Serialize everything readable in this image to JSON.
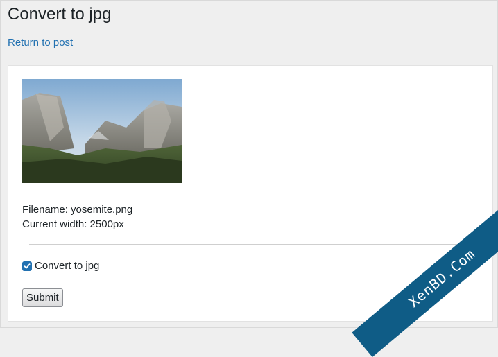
{
  "page": {
    "title": "Convert to jpg",
    "return_link": "Return to post"
  },
  "image": {
    "icon": "yosemite-landscape-thumbnail"
  },
  "file": {
    "filename_line": "Filename: yosemite.png",
    "width_line": "Current width: 2500px"
  },
  "form": {
    "convert_checkbox_label": "Convert to jpg",
    "convert_checked": true,
    "submit_label": "Submit"
  },
  "watermark": {
    "text": "XenBD.Com"
  },
  "colors": {
    "link": "#2271b1",
    "checkbox": "#2271b1",
    "ribbon": "#0f5c86"
  }
}
